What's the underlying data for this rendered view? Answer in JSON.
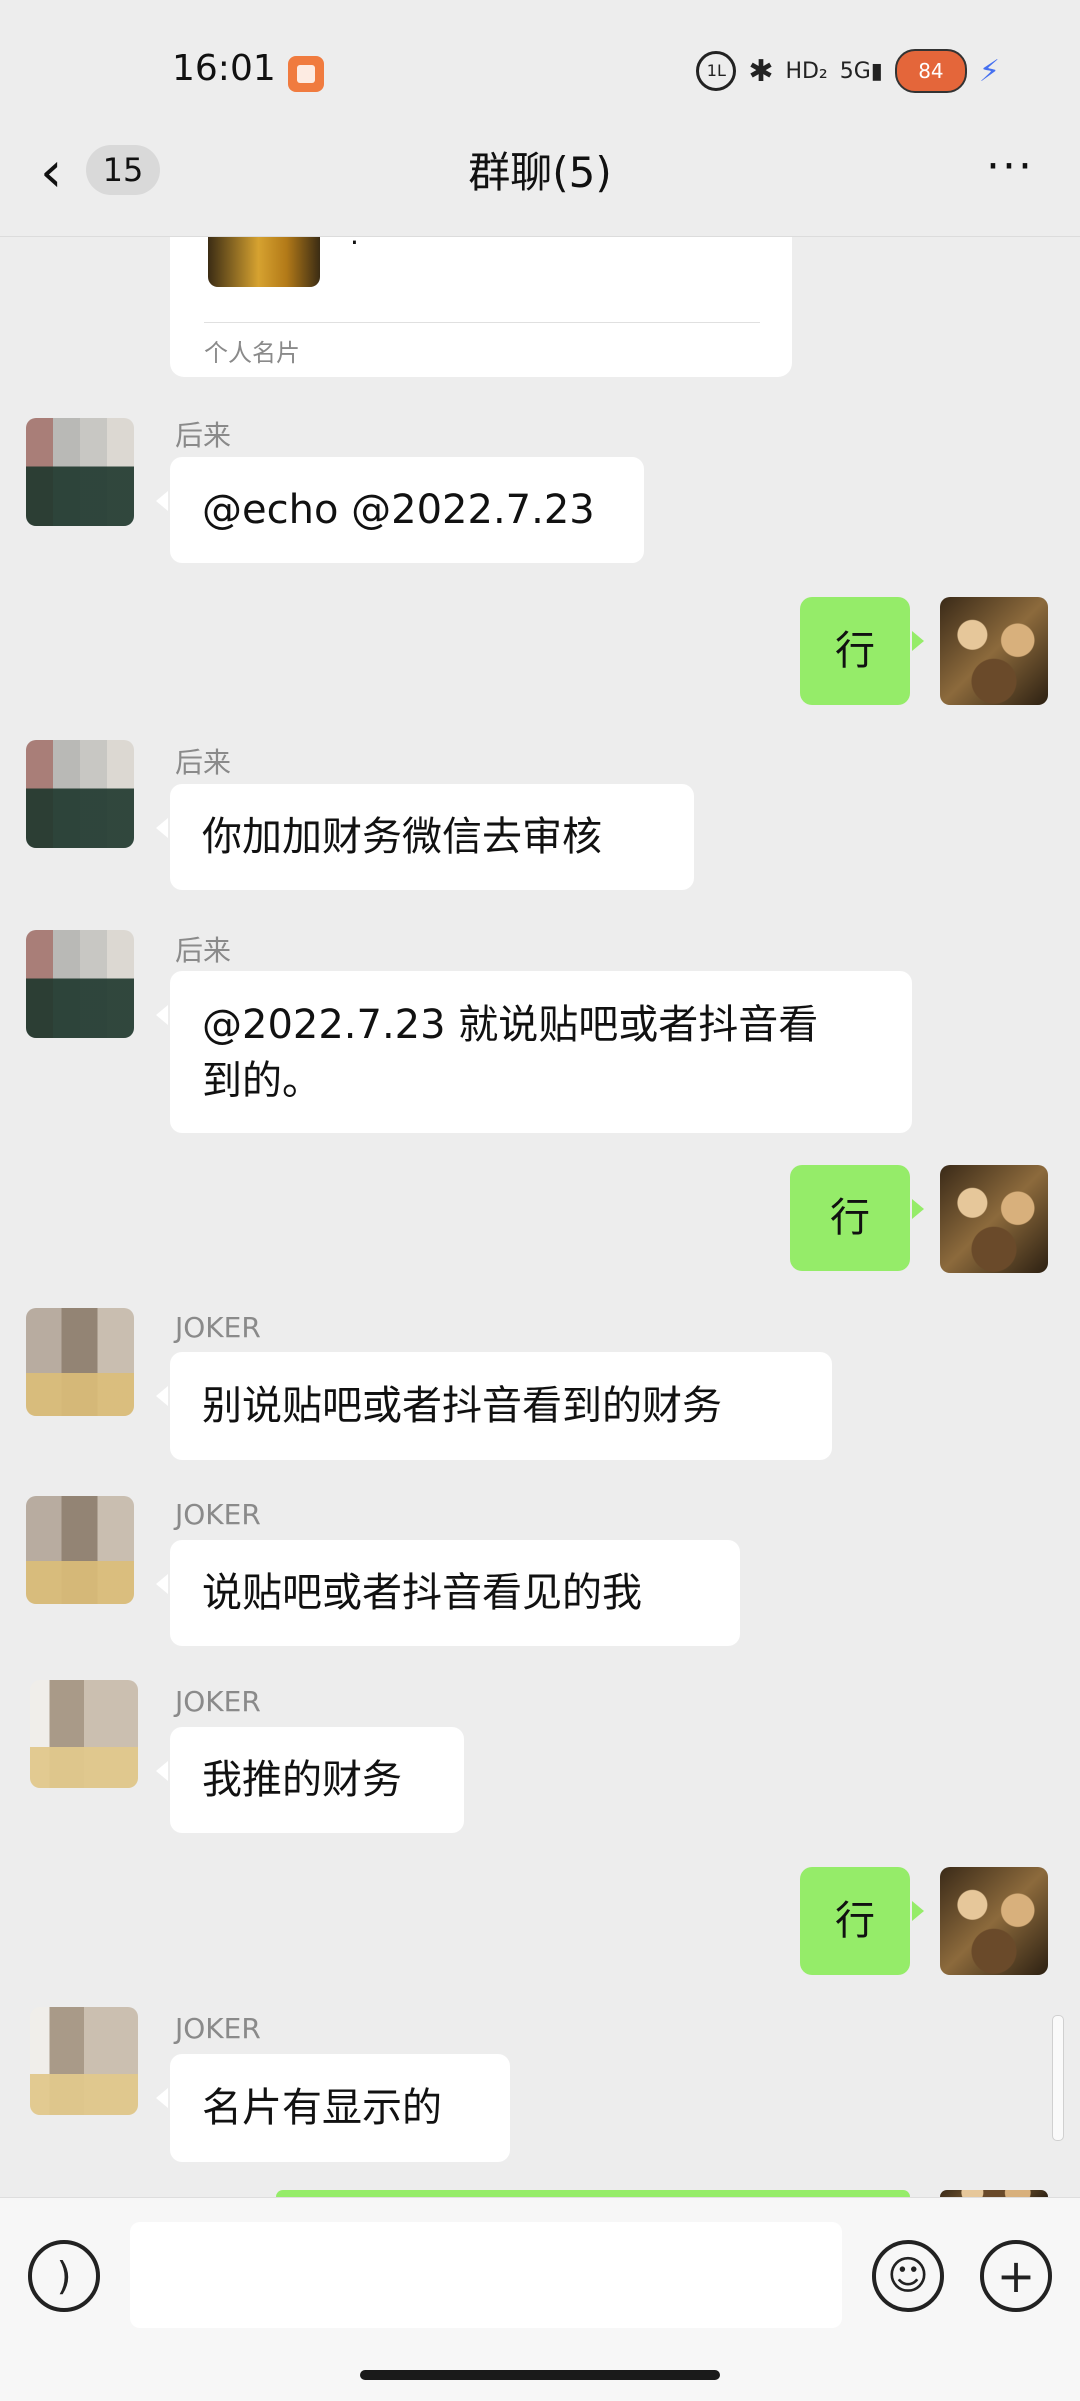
{
  "status_bar": {
    "time": "16:01",
    "battery": "84",
    "icons": [
      "book-app-icon",
      "circle-1l-icon",
      "bluetooth-icon",
      "hd-signal-icon",
      "5g-signal-icon",
      "battery-icon",
      "charging-bolt-icon"
    ]
  },
  "header": {
    "back_count": "15",
    "title": "群聊(5)",
    "more_label": "···"
  },
  "card": {
    "text": "·",
    "label": "个人名片"
  },
  "messages": [
    {
      "sender": "后来",
      "text": "@echo @2022.7.23",
      "side": "left"
    },
    {
      "sender": "",
      "text": "行",
      "side": "right"
    },
    {
      "sender": "后来",
      "text": "你加加财务微信去审核",
      "side": "left"
    },
    {
      "sender": "后来",
      "text_line1": "@2022.7.23 就说贴吧或者抖音看",
      "text_line2": "到的。",
      "side": "left"
    },
    {
      "sender": "",
      "text": "行",
      "side": "right"
    },
    {
      "sender": "JOKER",
      "text": "别说贴吧或者抖音看到的财务",
      "side": "left"
    },
    {
      "sender": "JOKER",
      "text": "说贴吧或者抖音看见的我",
      "side": "left"
    },
    {
      "sender": "JOKER",
      "text": "我推的财务",
      "side": "left"
    },
    {
      "sender": "",
      "text": "行",
      "side": "right"
    },
    {
      "sender": "JOKER",
      "text": "名片有显示的",
      "side": "left"
    }
  ],
  "input_bar": {
    "voice_icon": "voice-icon",
    "emoji_icon": "emoji-icon",
    "plus_icon": "plus-icon",
    "input_value": ""
  },
  "colors": {
    "background": "#ededed",
    "bubble_in": "#ffffff",
    "bubble_out": "#95ec69",
    "sender_name": "#8a8a8a"
  }
}
